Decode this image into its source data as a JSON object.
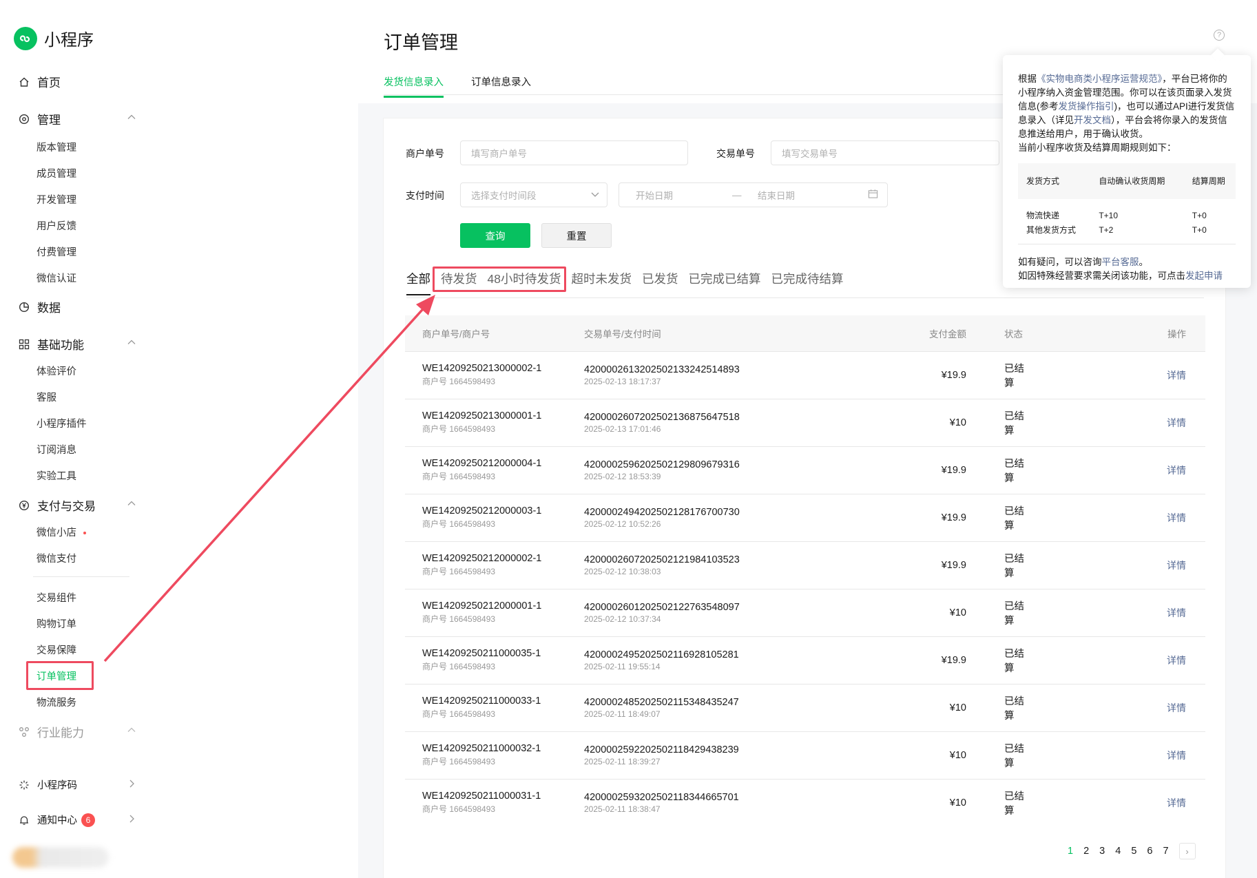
{
  "brand": {
    "name": "小程序"
  },
  "sidebar": {
    "home": "首页",
    "manage": {
      "label": "管理",
      "items": [
        "版本管理",
        "成员管理",
        "开发管理",
        "用户反馈",
        "付费管理",
        "微信认证"
      ]
    },
    "data": "数据",
    "basic": {
      "label": "基础功能",
      "items": [
        "体验评价",
        "客服",
        "小程序插件",
        "订阅消息",
        "实验工具"
      ]
    },
    "pay": {
      "label": "支付与交易",
      "items_a": [
        "微信小店",
        "微信支付"
      ],
      "items_b": [
        "交易组件",
        "购物订单",
        "交易保障",
        "订单管理",
        "物流服务"
      ]
    },
    "industry": "行业能力",
    "qrcode": "小程序码",
    "notify": {
      "label": "通知中心",
      "badge": "6"
    }
  },
  "page": {
    "title": "订单管理",
    "subtabs": [
      "发货信息录入",
      "订单信息录入"
    ]
  },
  "filters": {
    "merchant_label": "商户单号",
    "merchant_placeholder": "填写商户单号",
    "trade_label": "交易单号",
    "trade_placeholder": "填写交易单号",
    "paytime_label": "支付时间",
    "paytime_placeholder": "选择支付时间段",
    "start_date": "开始日期",
    "date_sep": "—",
    "end_date": "结束日期",
    "query": "查询",
    "reset": "重置"
  },
  "status_tabs": [
    "全部",
    "待发货",
    "48小时待发货",
    "超时未发货",
    "已发货",
    "已完成已结算",
    "已完成待结算"
  ],
  "table": {
    "headers": [
      "商户单号/商户号",
      "交易单号/支付时间",
      "支付金额",
      "状态",
      "操作"
    ],
    "merchant_prefix": "商户号 1664598493",
    "rows": [
      {
        "order": "WE14209250213000002-1",
        "trade": "4200002613202502133242514893",
        "time": "2025-02-13 18:17:37",
        "amount": "¥19.9",
        "status": "已结算",
        "action": "详情"
      },
      {
        "order": "WE14209250213000001-1",
        "trade": "4200002607202502136875647518",
        "time": "2025-02-13 17:01:46",
        "amount": "¥10",
        "status": "已结算",
        "action": "详情"
      },
      {
        "order": "WE14209250212000004-1",
        "trade": "4200002596202502129809679316",
        "time": "2025-02-12 18:53:39",
        "amount": "¥19.9",
        "status": "已结算",
        "action": "详情"
      },
      {
        "order": "WE14209250212000003-1",
        "trade": "4200002494202502128176700730",
        "time": "2025-02-12 10:52:26",
        "amount": "¥19.9",
        "status": "已结算",
        "action": "详情"
      },
      {
        "order": "WE14209250212000002-1",
        "trade": "4200002607202502121984103523",
        "time": "2025-02-12 10:38:03",
        "amount": "¥19.9",
        "status": "已结算",
        "action": "详情"
      },
      {
        "order": "WE14209250212000001-1",
        "trade": "4200002601202502122763548097",
        "time": "2025-02-12 10:37:34",
        "amount": "¥10",
        "status": "已结算",
        "action": "详情"
      },
      {
        "order": "WE14209250211000035-1",
        "trade": "4200002495202502116928105281",
        "time": "2025-02-11 19:55:14",
        "amount": "¥19.9",
        "status": "已结算",
        "action": "详情"
      },
      {
        "order": "WE14209250211000033-1",
        "trade": "4200002485202502115348435247",
        "time": "2025-02-11 18:49:07",
        "amount": "¥10",
        "status": "已结算",
        "action": "详情"
      },
      {
        "order": "WE14209250211000032-1",
        "trade": "4200002592202502118429438239",
        "time": "2025-02-11 18:39:27",
        "amount": "¥10",
        "status": "已结算",
        "action": "详情"
      },
      {
        "order": "WE14209250211000031-1",
        "trade": "4200002593202502118344665701",
        "time": "2025-02-11 18:38:47",
        "amount": "¥10",
        "status": "已结算",
        "action": "详情"
      }
    ]
  },
  "pager": {
    "pages": [
      "1",
      "2",
      "3",
      "4",
      "5",
      "6",
      "7"
    ],
    "current": "1"
  },
  "popover": {
    "p1": "根据",
    "link1": "《实物电商类小程序运营规范》",
    "p2": "，平台已将你的小程序纳入资金管理范围。你可以在该页面录入发货信息(参考",
    "link2": "发货操作指引",
    "p3": ")，也可以通过API进行发货信息录入（详见",
    "link3": "开发文档",
    "p4": "），平台会将你录入的发货信息推送给用户，用于确认收货。",
    "p5": "当前小程序收货及结算周期规则如下：",
    "headers": [
      "发货方式",
      "自动确认收货周期",
      "结算周期"
    ],
    "rows": [
      [
        "物流快递",
        "T+10",
        "T+0"
      ],
      [
        "其他发货方式",
        "T+2",
        "T+0"
      ]
    ],
    "f1": "如有疑问，可以咨询",
    "f1link": "平台客服",
    "f1end": "。",
    "f2": "如因特殊经营要求需关闭该功能，可点击",
    "f2link": "发起申请"
  },
  "colors": {
    "accent": "#07c160",
    "highlight": "#ee4a5f",
    "link": "#576b95"
  }
}
